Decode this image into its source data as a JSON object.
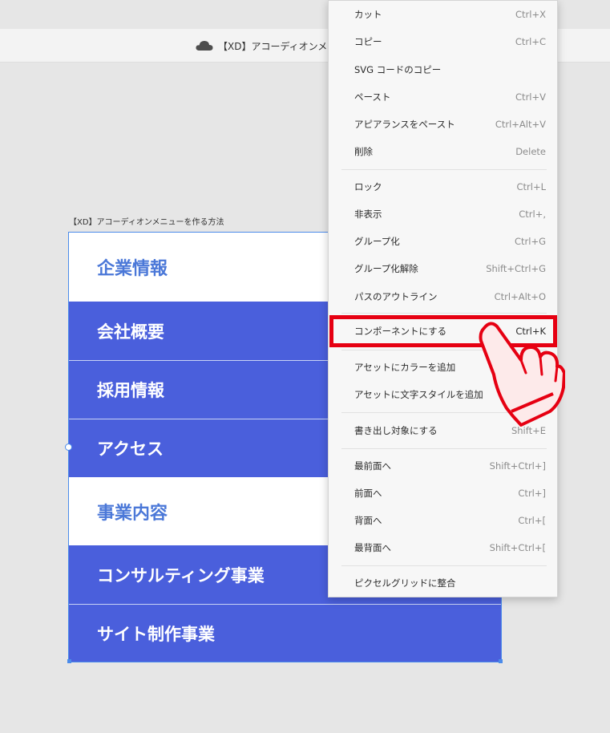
{
  "window": {
    "title": "【XD】アコーディオンメニュー",
    "cloud_icon": "cloud-icon"
  },
  "artboard": {
    "label": "【XD】アコーディオンメニューを作る方法",
    "rows": [
      {
        "text": "企業情報",
        "kind": "header"
      },
      {
        "text": "会社概要",
        "kind": "item"
      },
      {
        "text": "採用情報",
        "kind": "item"
      },
      {
        "text": "アクセス",
        "kind": "item"
      },
      {
        "text": "事業内容",
        "kind": "header"
      },
      {
        "text": "コンサルティング事業",
        "kind": "item"
      },
      {
        "text": "サイト制作事業",
        "kind": "item"
      }
    ]
  },
  "context_menu": {
    "items": [
      {
        "label": "カット",
        "shortcut": "Ctrl+X"
      },
      {
        "label": "コピー",
        "shortcut": "Ctrl+C"
      },
      {
        "label": "SVG コードのコピー",
        "shortcut": ""
      },
      {
        "label": "ペースト",
        "shortcut": "Ctrl+V"
      },
      {
        "label": "アピアランスをペースト",
        "shortcut": "Ctrl+Alt+V"
      },
      {
        "label": "削除",
        "shortcut": "Delete"
      },
      {
        "label": "ロック",
        "shortcut": "Ctrl+L"
      },
      {
        "label": "非表示",
        "shortcut": "Ctrl+,"
      },
      {
        "label": "グループ化",
        "shortcut": "Ctrl+G"
      },
      {
        "label": "グループ化解除",
        "shortcut": "Shift+Ctrl+G"
      },
      {
        "label": "パスのアウトライン",
        "shortcut": "Ctrl+Alt+O"
      },
      {
        "label": "コンポーネントにする",
        "shortcut": "Ctrl+K"
      },
      {
        "label": "アセットにカラーを追加",
        "shortcut": ""
      },
      {
        "label": "アセットに文字スタイルを追加",
        "shortcut": "Sh"
      },
      {
        "label": "書き出し対象にする",
        "shortcut": "Shift+E"
      },
      {
        "label": "最前面へ",
        "shortcut": "Shift+Ctrl+]"
      },
      {
        "label": "前面へ",
        "shortcut": "Ctrl+]"
      },
      {
        "label": "背面へ",
        "shortcut": "Ctrl+["
      },
      {
        "label": "最背面へ",
        "shortcut": "Shift+Ctrl+["
      },
      {
        "label": "ピクセルグリッドに整合",
        "shortcut": ""
      }
    ],
    "highlighted_item": "コンポーネントにする",
    "highlight_color": "#e60012",
    "pointer_icon": "hand-pointer-icon"
  },
  "colors": {
    "menu_item_bg": "#4a5fdc",
    "menu_header_text": "#4b78d8",
    "selection": "#4b8bea"
  }
}
